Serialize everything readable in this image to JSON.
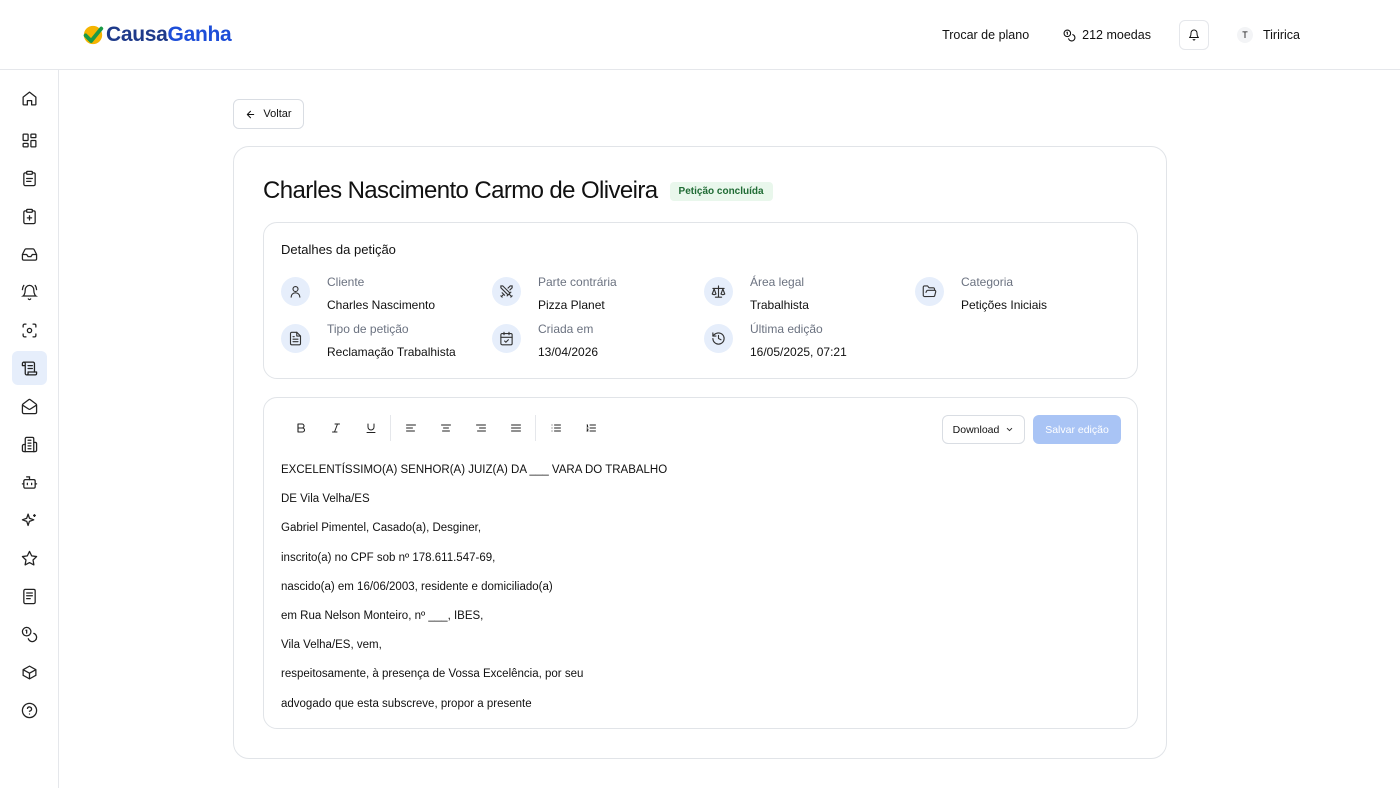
{
  "brand": {
    "name_part1": "Causa",
    "name_part2": "Ganha",
    "logo_check_color": "#1a9a46",
    "logo_ring_color": "#f5b400"
  },
  "header": {
    "change_plan": "Trocar de plano",
    "coins": "212 moedas",
    "user_initial": "T",
    "user_name": "Tiririca"
  },
  "sidebar": {
    "items": [
      {
        "icon": "home-icon"
      },
      {
        "icon": "dashboard-icon"
      },
      {
        "icon": "clipboard-icon"
      },
      {
        "icon": "clipboard-plus-icon"
      },
      {
        "icon": "inbox-icon"
      },
      {
        "icon": "bell-ring-icon"
      },
      {
        "icon": "scan-face-icon"
      },
      {
        "icon": "scroll-icon",
        "active": true
      },
      {
        "icon": "mail-open-icon"
      },
      {
        "icon": "building-icon"
      },
      {
        "icon": "bot-icon"
      },
      {
        "icon": "sparkles-icon"
      },
      {
        "icon": "star-icon"
      },
      {
        "icon": "document-list-icon"
      },
      {
        "icon": "coins-icon"
      },
      {
        "icon": "package-icon"
      },
      {
        "icon": "help-circle-icon"
      }
    ]
  },
  "back_label": "Voltar",
  "petition": {
    "title": "Charles Nascimento Carmo de Oliveira",
    "status": "Petição concluída",
    "details_title": "Detalhes da petição",
    "details": [
      {
        "icon": "user-icon",
        "label": "Cliente",
        "value": "Charles Nascimento"
      },
      {
        "icon": "swords-icon",
        "label": "Parte contrária",
        "value": "Pizza Planet"
      },
      {
        "icon": "scale-icon",
        "label": "Área legal",
        "value": "Trabalhista"
      },
      {
        "icon": "folder-open-icon",
        "label": "Categoria",
        "value": "Petições Iniciais"
      },
      {
        "icon": "file-text-icon",
        "label": "Tipo de petição",
        "value": "Reclamação Trabalhista"
      },
      {
        "icon": "calendar-check-icon",
        "label": "Criada em",
        "value": "13/04/2026"
      },
      {
        "icon": "history-icon",
        "label": "Última edição",
        "value": "16/05/2025, 07:21"
      }
    ]
  },
  "editor": {
    "download_label": "Download",
    "save_label": "Salvar edição",
    "lines": [
      "EXCELENTÍSSIMO(A) SENHOR(A) JUIZ(A) DA ___ VARA DO TRABALHO",
      "DE Vila Velha/ES",
      "Gabriel Pimentel, Casado(a), Desginer,",
      "inscrito(a) no CPF sob nº 178.611.547-69,",
      "nascido(a) em 16/06/2003, residente e domiciliado(a)",
      "em Rua Nelson Monteiro, nº ___, IBES,",
      "Vila Velha/ES, vem,",
      "respeitosamente, à presença de Vossa Excelência, por seu",
      "advogado que esta subscreve, propor a presente"
    ]
  },
  "colors": {
    "accent": "#1d4ed8",
    "icon_bg": "#e6eefb",
    "save_disabled": "#a9c4f5",
    "badge_bg": "#e9f7ec",
    "badge_fg": "#1f6b34"
  }
}
